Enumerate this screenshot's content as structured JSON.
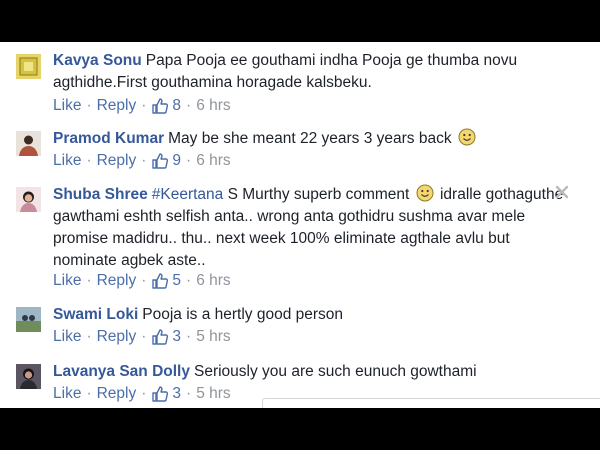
{
  "actions": {
    "like": "Like",
    "reply": "Reply",
    "separator": "·"
  },
  "comments": [
    {
      "author": "Kavya Sonu",
      "text": "Papa Pooja ee gouthami indha Pooja ge thumba novu agthidhe.First gouthamina horagade kalsbeku.",
      "likes": "8",
      "time": "6 hrs",
      "avatar_color": "#d8c23a"
    },
    {
      "author": "Pramod Kumar",
      "text": "May be she meant 22 years 3 years back",
      "likes": "9",
      "time": "6 hrs",
      "avatar_color": "#b0523e"
    },
    {
      "author": "Shuba Shree",
      "hashtag": "#Keertana",
      "text_a": "S Murthy superb comment",
      "text_b": "idralle gothaguthe gawthami eshth selfish anta.. wrong anta gothidru sushma avar mele promise madidru.. thu.. next week 100% eliminate agthale avlu but nominate agbek aste..",
      "likes": "5",
      "time": "6 hrs",
      "avatar_color": "#c98a9a"
    },
    {
      "author": "Swami Loki",
      "text": "Pooja is a hertly good person",
      "likes": "3",
      "time": "5 hrs",
      "avatar_color": "#7a96a8"
    },
    {
      "author": "Lavanya San Dolly",
      "text": "Seriously you are such eunuch gowthami",
      "likes": "3",
      "time": "5 hrs",
      "avatar_color": "#3a3a40"
    }
  ],
  "icons": {
    "like": "thumbs-up-icon",
    "emoji": "smiley-icon",
    "close": "close-icon"
  },
  "colors": {
    "author": "#365899",
    "link": "#4b6ea9",
    "meta": "#90949c",
    "text": "#1d2129"
  }
}
